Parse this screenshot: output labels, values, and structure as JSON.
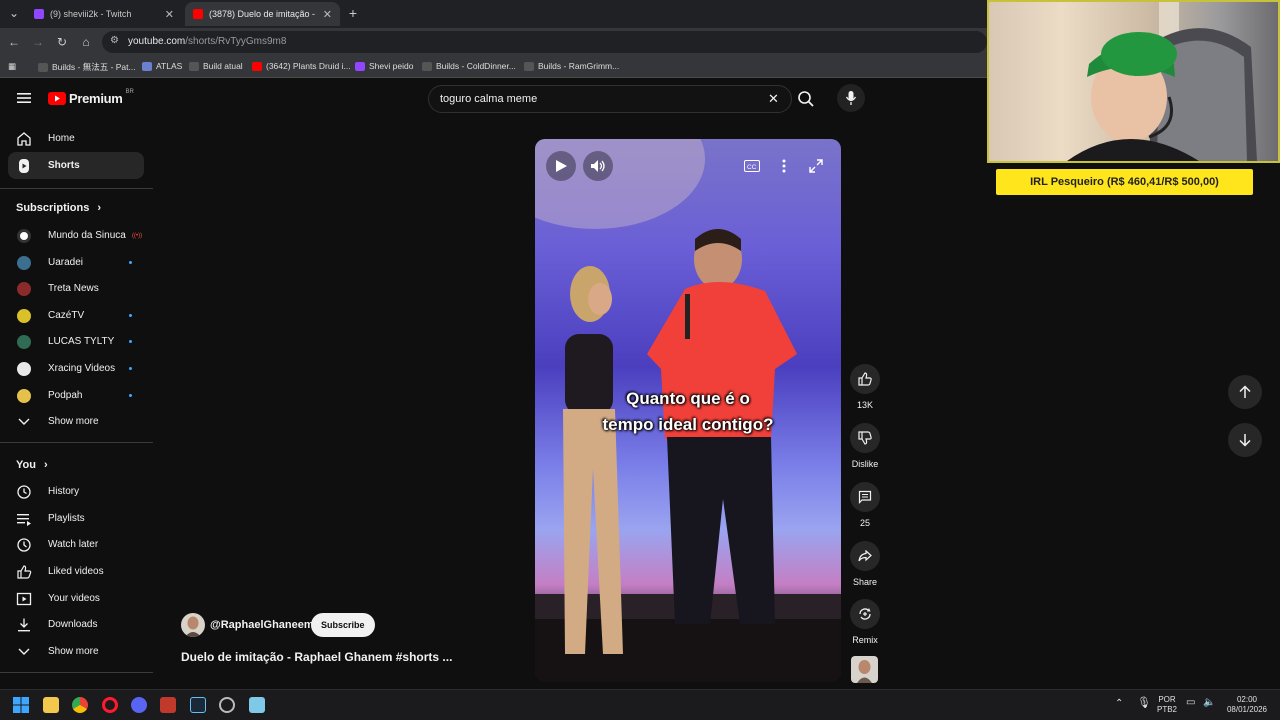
{
  "browser": {
    "tabs": [
      {
        "title": "(9) sheviii2k - Twitch",
        "active": false
      },
      {
        "title": "(3878) Duelo de imitação - Raphael",
        "active": true
      }
    ],
    "url_host": "youtube.com",
    "url_path": "/shorts/RvTyyGms9m8",
    "bookmarks": [
      "Builds - 無法五 - Pat...",
      "ATLAS",
      "Build atual",
      "(3642) Plants Druid i...",
      "Shevi peido",
      "Builds - ColdDinner...",
      "Builds - RamGrimm..."
    ]
  },
  "youtube": {
    "logo_text": "Premium",
    "logo_region": "BR",
    "search_query": "toguro calma meme",
    "sidebar": {
      "main": [
        {
          "label": "Home",
          "icon": "home-icon"
        },
        {
          "label": "Shorts",
          "icon": "shorts-icon",
          "active": true
        }
      ],
      "subscriptions_header": "Subscriptions",
      "subscriptions": [
        {
          "label": "Mundo da Sinuca",
          "live": true,
          "color": "#ffffff"
        },
        {
          "label": "Uaradei",
          "dot": true,
          "color": "#3b6e8f"
        },
        {
          "label": "Treta News",
          "dot": false,
          "color": "#8b2a2a"
        },
        {
          "label": "CazéTV",
          "dot": true,
          "color": "#d9c12a"
        },
        {
          "label": "LUCAS TYLTY",
          "dot": true,
          "color": "#2f6b55"
        },
        {
          "label": "Xracing Videos",
          "dot": true,
          "color": "#e8e8e8"
        },
        {
          "label": "Podpah",
          "dot": true,
          "color": "#e3c14a"
        }
      ],
      "show_more": "Show more",
      "you_header": "You",
      "you": [
        {
          "label": "History",
          "icon": "history-icon"
        },
        {
          "label": "Playlists",
          "icon": "playlists-icon"
        },
        {
          "label": "Watch later",
          "icon": "watch-later-icon"
        },
        {
          "label": "Liked videos",
          "icon": "liked-icon"
        },
        {
          "label": "Your videos",
          "icon": "your-videos-icon"
        },
        {
          "label": "Downloads",
          "icon": "downloads-icon"
        }
      ],
      "show_more_2": "Show more"
    },
    "short": {
      "caption_line1": "Quanto que é o",
      "caption_line2": "tempo ideal contigo?",
      "channel": "@RaphaelGhaneem",
      "subscribe": "Subscribe",
      "title": "Duelo de imitação - Raphael Ghanem #shorts ...",
      "likes": "13K",
      "dislike": "Dislike",
      "comments": "25",
      "share": "Share",
      "remix": "Remix"
    }
  },
  "stream_overlay": {
    "goal_text": "IRL Pesqueiro (R$ 460,41/R$ 500,00)",
    "goal_progress": 0.92
  },
  "taskbar": {
    "lang": "POR",
    "layout": "PTB2",
    "time": "02:00",
    "date": "08/01/2026"
  }
}
